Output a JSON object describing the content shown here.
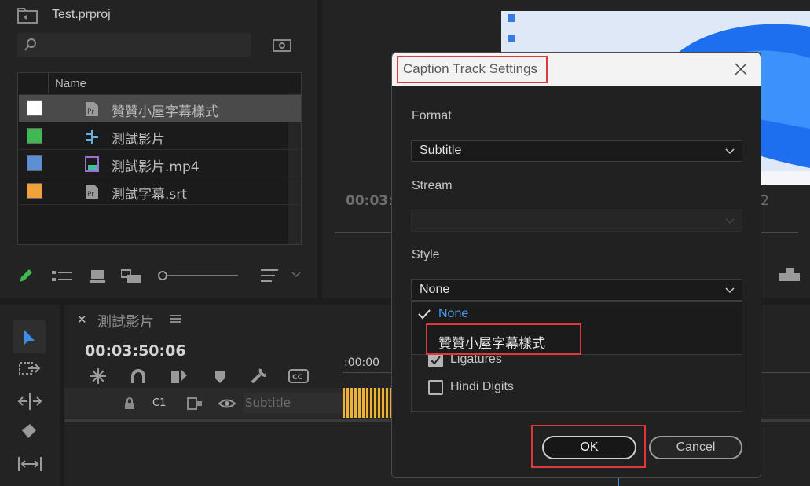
{
  "project": {
    "title": "Test.prproj",
    "column_name": "Name",
    "items": [
      {
        "name": "贊贊小屋字幕樣式",
        "color": "#ffffff",
        "icon": "premiere-file-icon"
      },
      {
        "name": "測試影片",
        "color": "#3fb950",
        "icon": "sequence-icon"
      },
      {
        "name": "測試影片.mp4",
        "color": "#5b8fd6",
        "icon": "video-clip-icon"
      },
      {
        "name": "測試字幕.srt",
        "color": "#f0a23a",
        "icon": "premiere-file-icon"
      }
    ]
  },
  "monitor": {
    "timecode": "00:03:",
    "zoom": "2"
  },
  "timeline": {
    "sequence_name": "測試影片",
    "timecode": "00:03:50:06",
    "ruler_start": ":00:00",
    "track_label": "C1",
    "track_name": "Subtitle"
  },
  "dialog": {
    "title": "Caption Track Settings",
    "format_label": "Format",
    "format_value": "Subtitle",
    "stream_label": "Stream",
    "stream_value": "",
    "style_label": "Style",
    "style_value": "None",
    "style_options": [
      "None",
      "贊贊小屋字幕樣式"
    ],
    "ligatures_label": "Ligatures",
    "hindi_digits_label": "Hindi Digits",
    "ok_label": "OK",
    "cancel_label": "Cancel"
  },
  "colors": {
    "highlight": "#e0393b",
    "selected_option": "#4d9bf0"
  }
}
